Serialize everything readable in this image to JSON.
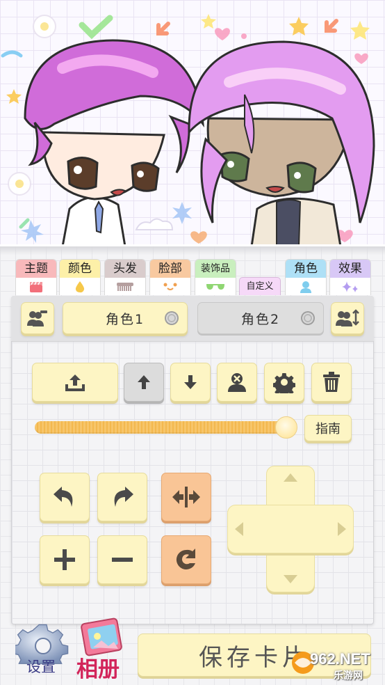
{
  "tabs": [
    {
      "label": "主题",
      "color": "#f8b9bb"
    },
    {
      "label": "颜色",
      "color": "#fdf0a8"
    },
    {
      "label": "头发",
      "color": "#d9cccc"
    },
    {
      "label": "脸部",
      "color": "#f8c9a0"
    },
    {
      "label": "装饰品",
      "color": "#c9efbe"
    },
    {
      "label": "自定义",
      "color": "#f6d9f8"
    },
    {
      "label": "角色",
      "color": "#aee0f6"
    },
    {
      "label": "效果",
      "color": "#d8c8f6"
    }
  ],
  "character_tabs": {
    "active": "角色1",
    "inactive": "角色2"
  },
  "toolbar_icons": [
    "upload-icon",
    "arrow-up-icon",
    "arrow-down-icon",
    "remove-person-icon",
    "gear-icon",
    "trash-icon"
  ],
  "guide_label": "指南",
  "slider": {
    "value": 1.0
  },
  "bottom": {
    "settings_label": "设置",
    "album_label": "相册",
    "save_label": "保存卡片"
  },
  "watermark": {
    "brand": "962.NET",
    "sub": "乐游网"
  }
}
